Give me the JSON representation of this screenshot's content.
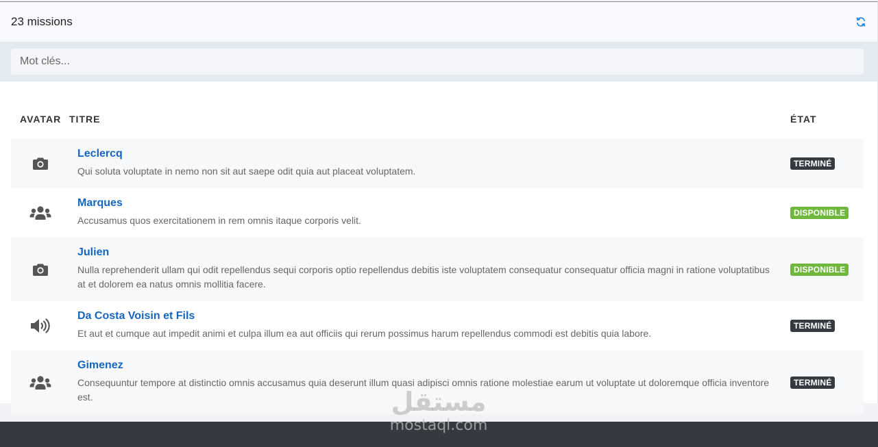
{
  "header": {
    "title": "23 missions",
    "refresh_icon": "refresh-icon"
  },
  "search": {
    "placeholder": "Mot clés..."
  },
  "table": {
    "columns": [
      "AVATAR",
      "TITRE",
      "ÉTAT"
    ],
    "rows": [
      {
        "icon": "camera-icon",
        "title": "Leclercq",
        "description": "Qui soluta voluptate in nemo non sit aut saepe odit quia aut placeat voluptatem.",
        "status": "TERMINÉ"
      },
      {
        "icon": "users-icon",
        "title": "Marques",
        "description": "Accusamus quos exercitationem in rem omnis itaque corporis velit.",
        "status": "DISPONIBLE"
      },
      {
        "icon": "camera-icon",
        "title": "Julien",
        "description": "Nulla reprehenderit ullam qui odit repellendus sequi corporis optio repellendus debitis iste voluptatem consequatur consequatur officia magni in ratione voluptatibus at et dolorem ea natus omnis mollitia facere.",
        "status": "DISPONIBLE"
      },
      {
        "icon": "volume-icon",
        "title": "Da Costa Voisin et Fils",
        "description": "Et aut et cumque aut impedit animi et culpa illum ea aut officiis qui rerum possimus harum repellendus commodi est debitis quia labore.",
        "status": "TERMINÉ"
      },
      {
        "icon": "users-icon",
        "title": "Gimenez",
        "description": "Consequuntur tempore at distinctio omnis accusamus quia deserunt illum quasi adipisci omnis ratione molestiae earum ut voluptate ut doloremque officia inventore est.",
        "status": "TERMINÉ"
      }
    ]
  },
  "watermark": {
    "arabic": "مستقل",
    "latin": "mostaql.com"
  },
  "colors": {
    "link": "#1565c0",
    "badge_done": "#343a40",
    "badge_available": "#6fb83d",
    "refresh": "#1e88e5",
    "footer": "#343a40"
  }
}
